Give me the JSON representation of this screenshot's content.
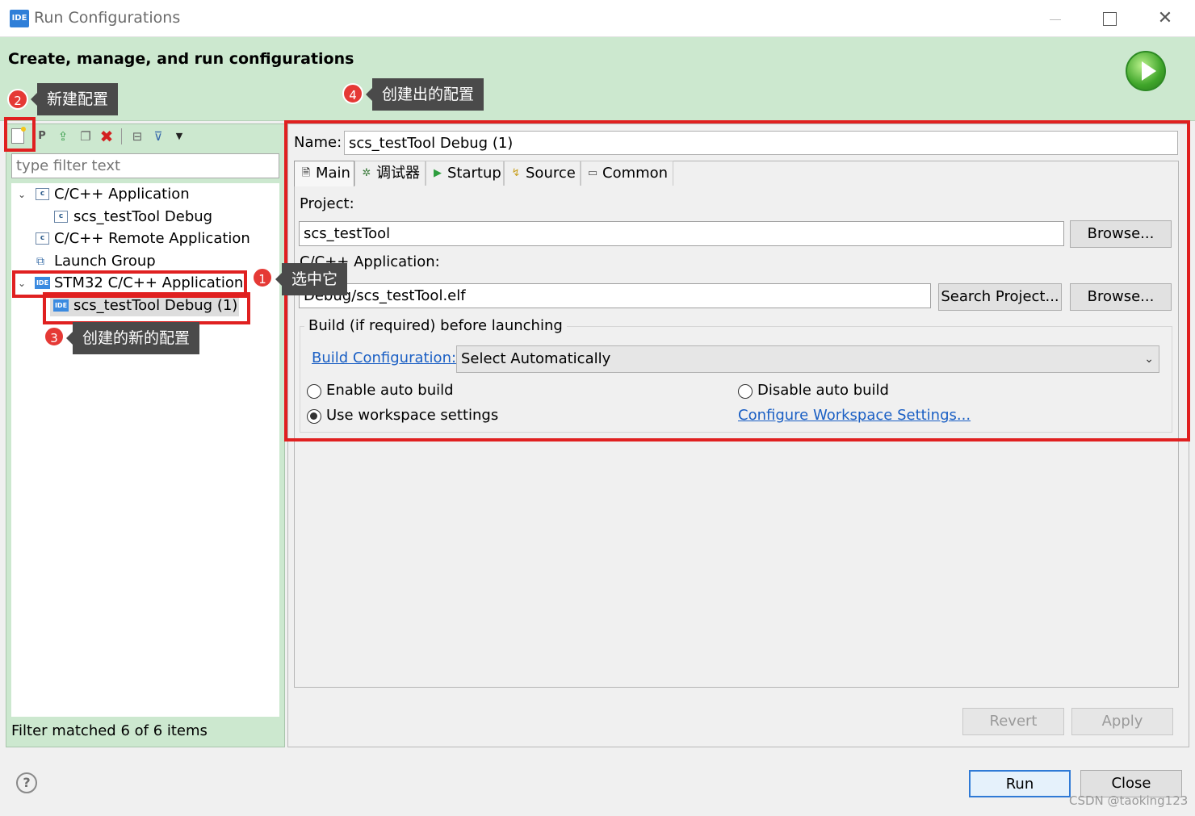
{
  "window": {
    "icon_label": "IDE",
    "title": "Run Configurations",
    "close_glyph": "✕"
  },
  "header": {
    "title": "Create, manage, and run configurations",
    "run_icon": "run-play-icon"
  },
  "annotations": [
    {
      "num": "1",
      "text": "选中它"
    },
    {
      "num": "2",
      "text": "新建配置"
    },
    {
      "num": "3",
      "text": "创建的新的配置"
    },
    {
      "num": "4",
      "text": "创建出的配置"
    }
  ],
  "toolbar": {
    "icons": [
      "new-configuration-icon",
      "new-prototype-icon",
      "export-icon",
      "duplicate-icon",
      "delete-icon",
      "collapse-all-icon",
      "filter-icon",
      "view-menu-icon"
    ],
    "proto_glyph": "P",
    "export_glyph": "⇪",
    "dup_glyph": "❐",
    "delete_glyph": "✖",
    "collapse_glyph": "⊟",
    "filter_glyph": "⊽",
    "menu_glyph": "▼"
  },
  "filter": {
    "placeholder": "type filter text",
    "status": "Filter matched 6 of 6 items"
  },
  "tree": {
    "expanded_glyph": "⌄",
    "file_icon_label": "c",
    "ide_icon_label": "IDE",
    "launch_glyph": "⧉",
    "items": [
      {
        "label": "C/C++ Application"
      },
      {
        "label": "scs_testTool Debug"
      },
      {
        "label": "C/C++ Remote Application"
      },
      {
        "label": "Launch Group"
      },
      {
        "label": "STM32 C/C++ Application"
      },
      {
        "label": "scs_testTool Debug (1)"
      }
    ]
  },
  "config": {
    "name_label": "Name:",
    "name_value": "scs_testTool Debug (1)",
    "tabs": [
      {
        "label": "Main",
        "icon": "main-tab-icon",
        "glyph": "🗎"
      },
      {
        "label": "调试器",
        "icon": "debugger-tab-icon",
        "glyph": "✲"
      },
      {
        "label": "Startup",
        "icon": "startup-tab-icon",
        "glyph": "▶"
      },
      {
        "label": "Source",
        "icon": "source-tab-icon",
        "glyph": "↯"
      },
      {
        "label": "Common",
        "icon": "common-tab-icon",
        "glyph": "▭"
      }
    ],
    "project_label": "Project:",
    "project_value": "scs_testTool",
    "browse_label": "Browse...",
    "app_label": "C/C++ Application:",
    "app_value": "Debug/scs_testTool.elf",
    "search_project_label": "Search Project...",
    "build_group_label": "Build (if required) before launching",
    "build_config_link": "Build Configuration:",
    "build_config_value": "Select Automatically",
    "select_arrow": "⌄",
    "radios": {
      "enable_auto_build": "Enable auto build",
      "disable_auto_build": "Disable auto build",
      "use_workspace": "Use workspace settings",
      "selected": "use_workspace"
    },
    "workspace_link": "Configure Workspace Settings...",
    "revert_label": "Revert",
    "apply_label": "Apply"
  },
  "footer": {
    "help_glyph": "?",
    "run_label": "Run",
    "close_label": "Close",
    "watermark": "CSDN @taoking123"
  },
  "colors": {
    "header_bg": "#cce8cf",
    "annotation_red": "#e02020",
    "link_blue": "#1a5fc4",
    "callout_bg": "#4a4a4a"
  }
}
